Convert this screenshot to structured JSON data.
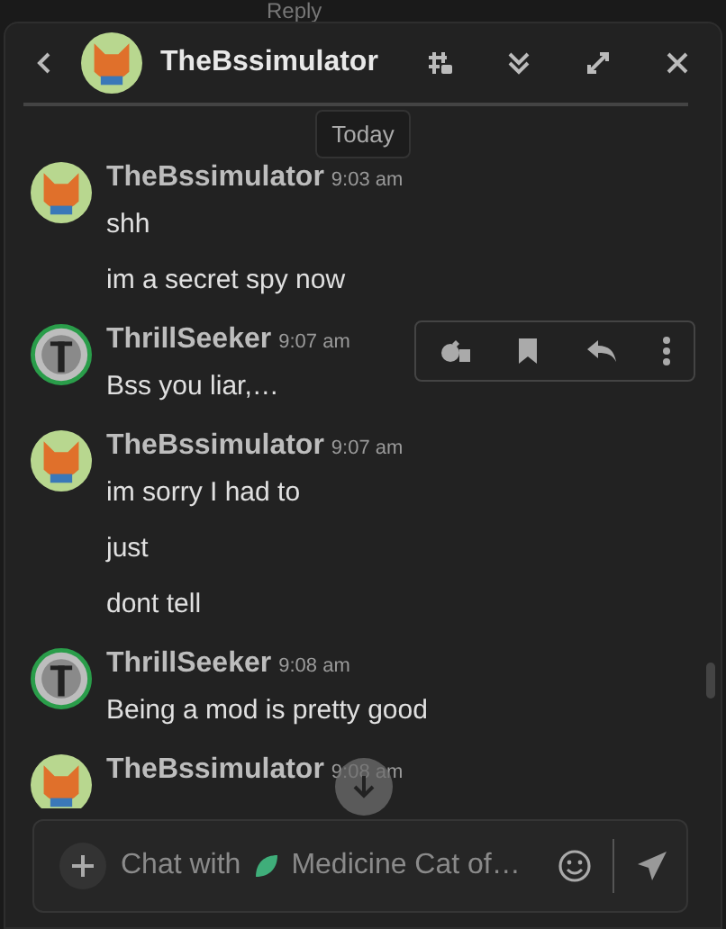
{
  "behind": {
    "reply_label": "Reply"
  },
  "header": {
    "title": "TheBssimulator"
  },
  "date_divider": "Today",
  "messages": [
    {
      "author": "TheBssimulator",
      "time": "9:03 am",
      "kind": "orange",
      "lines": [
        "shh",
        "im a secret spy now"
      ],
      "hovered": false
    },
    {
      "author": "ThrillSeeker",
      "time": "9:07 am",
      "kind": "grey",
      "lines": [
        "Bss you liar,…"
      ],
      "hovered": true
    },
    {
      "author": "TheBssimulator",
      "time": "9:07 am",
      "kind": "orange",
      "lines": [
        "im sorry I had to",
        "just",
        "dont tell"
      ],
      "hovered": false
    },
    {
      "author": "ThrillSeeker",
      "time": "9:08 am",
      "kind": "grey",
      "lines": [
        "Being a mod is pretty good"
      ],
      "hovered": false
    },
    {
      "author": "TheBssimulator",
      "time": "9:08 am",
      "kind": "orange",
      "hovered": false
    }
  ],
  "composer": {
    "prefix": "Chat with",
    "channel": "Medicine Cat of…"
  }
}
